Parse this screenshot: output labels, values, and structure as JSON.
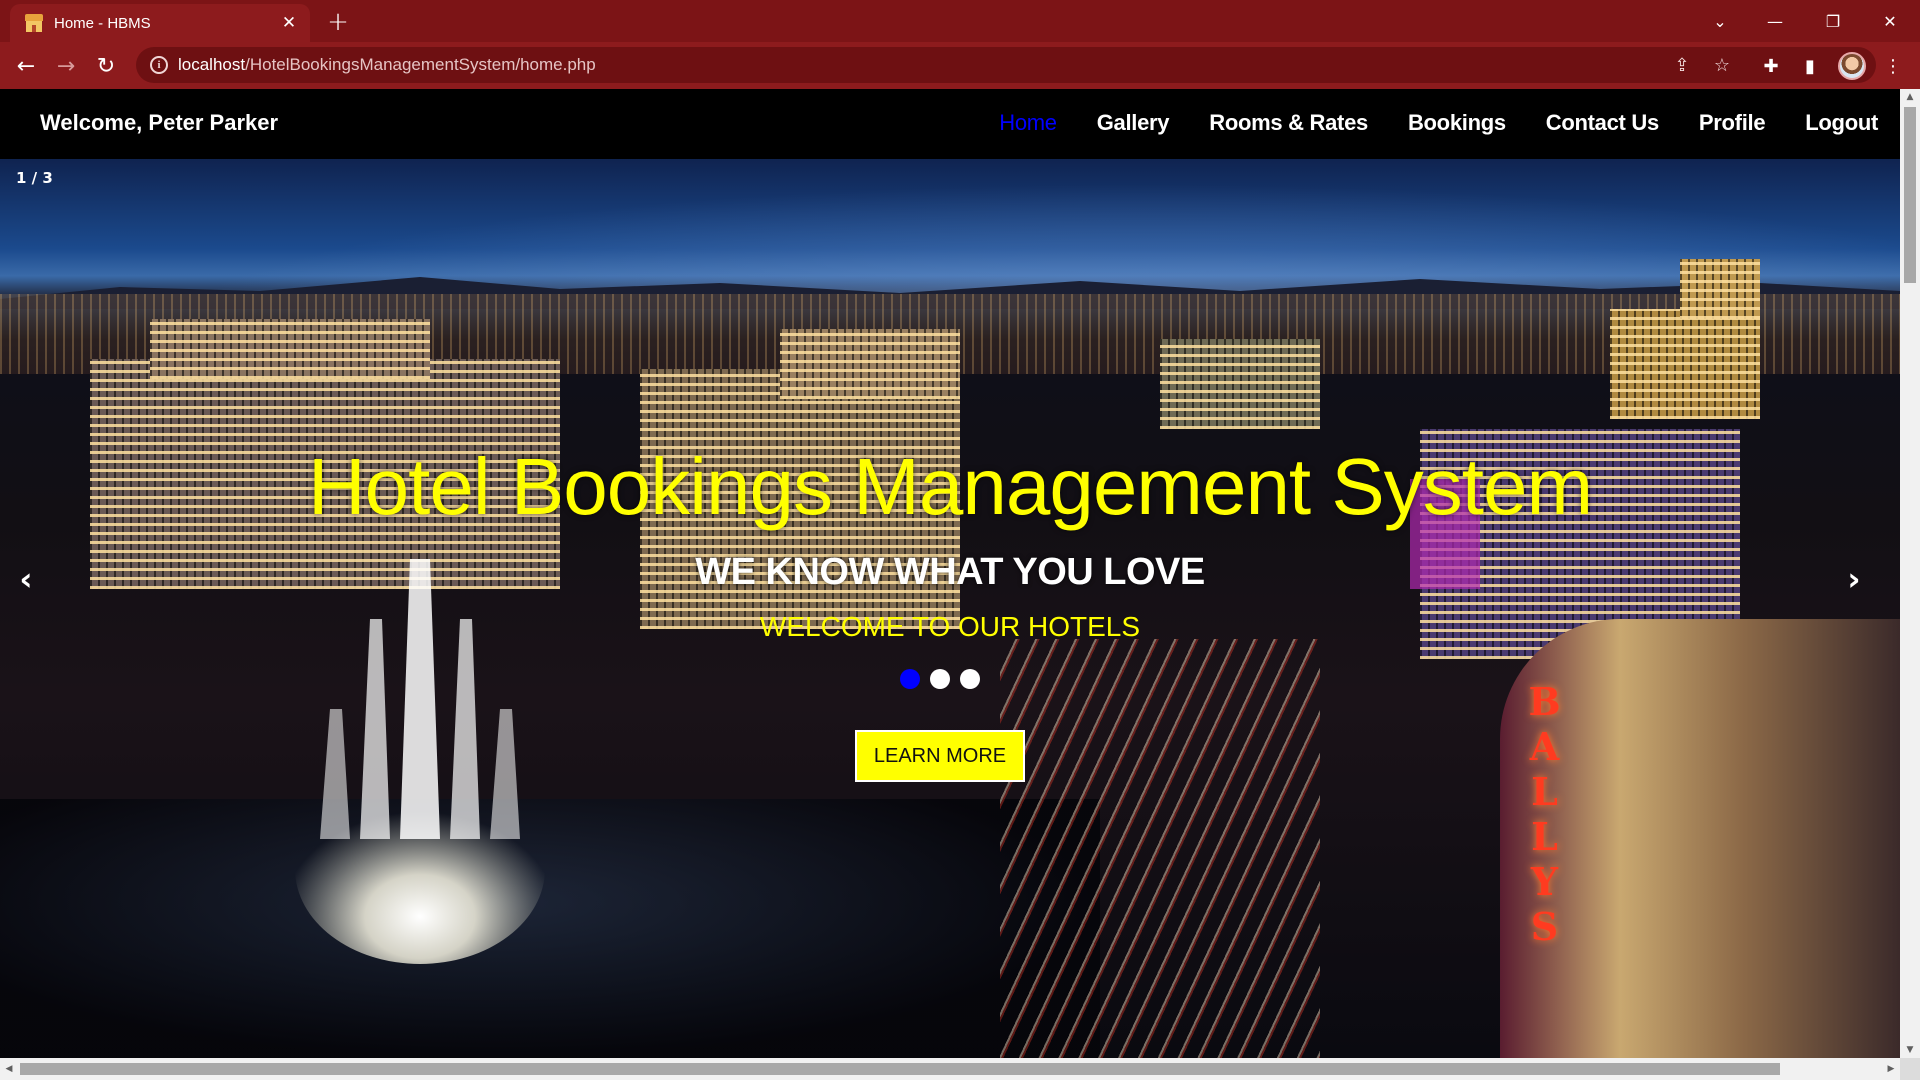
{
  "browser": {
    "tab_title": "Home - HBMS",
    "tab_close": "✕",
    "new_tab": "+",
    "url_host": "localhost",
    "url_path": "/HotelBookingsManagementSystem/home.php",
    "window_controls": {
      "dropdown": "⌄",
      "minimize": "—",
      "restore": "❐",
      "close": "✕"
    }
  },
  "site_nav": {
    "welcome": "Welcome, Peter Parker",
    "links": [
      {
        "label": "Home",
        "active": true
      },
      {
        "label": "Gallery",
        "active": false
      },
      {
        "label": "Rooms & Rates",
        "active": false
      },
      {
        "label": "Bookings",
        "active": false
      },
      {
        "label": "Contact Us",
        "active": false
      },
      {
        "label": "Profile",
        "active": false
      },
      {
        "label": "Logout",
        "active": false
      }
    ]
  },
  "hero": {
    "slide_counter": "1 / 3",
    "title": "Hotel Bookings Management System",
    "subtitle": "WE KNOW WHAT YOU LOVE",
    "tagline": "WELCOME TO OUR HOTELS",
    "button_label": "LEARN MORE",
    "prev_arrow": "‹",
    "next_arrow": "›",
    "current_slide": 1,
    "total_slides": 3,
    "sign_text": "BALLYS"
  },
  "colors": {
    "chrome": "#8d1b1d",
    "tabstrip": "#7c1416",
    "nav_bg": "#000000",
    "active_link": "#0000ff",
    "hero_title": "#ffff00",
    "button_bg": "#ffff00"
  }
}
